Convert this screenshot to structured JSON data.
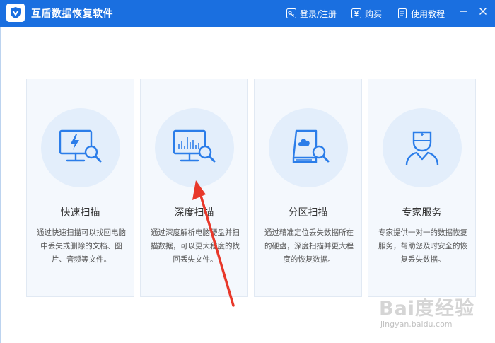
{
  "app": {
    "title": "互盾数据恢复软件"
  },
  "nav": {
    "login_label": "登录/注册",
    "buy_label": "购买",
    "help_label": "使用教程"
  },
  "window_controls": {
    "minimize": "–",
    "close": "✕"
  },
  "cards": [
    {
      "title": "快速扫描",
      "desc": "通过快速扫描可以找回电脑中丢失或删除的文档、图片、音频等文件。",
      "icon": "monitor-lightning-search-icon"
    },
    {
      "title": "深度扫描",
      "desc": "通过深度解析电脑硬盘并扫描数据，可以更大程度的找回丢失文件。",
      "icon": "monitor-chart-search-icon"
    },
    {
      "title": "分区扫描",
      "desc": "通过精准定位丢失数据所在的硬盘，深度扫描并更大程度的恢复数据。",
      "icon": "disk-cloud-search-icon"
    },
    {
      "title": "专家服务",
      "desc": "专家提供一对一的数据恢复服务，帮助您及时安全的恢复丢失数据。",
      "icon": "doctor-icon"
    }
  ],
  "watermark": {
    "brand": "Bai度经验",
    "url": "jingyan.baidu.com"
  },
  "colors": {
    "titlebar": "#1a6fe0",
    "card_bg": "#f4f8fd",
    "icon_blue": "#2b7de9",
    "arrow": "#e8382a"
  }
}
